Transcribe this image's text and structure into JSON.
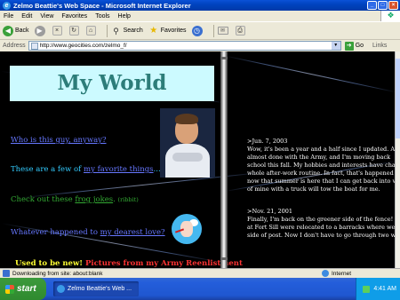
{
  "window": {
    "title": "Zelmo Beattie's Web Space - Microsoft Internet Explorer",
    "buttons": [
      "_",
      "□",
      "×"
    ]
  },
  "menu": [
    "File",
    "Edit",
    "View",
    "Favorites",
    "Tools",
    "Help"
  ],
  "toolbar": {
    "back_label": "Back",
    "search_label": "Search",
    "favorites_label": "Favorites"
  },
  "address": {
    "label": "Address",
    "url": "http://www.geocities.com/zelmo_f/",
    "go_label": "Go",
    "links_label": "Links"
  },
  "page": {
    "heading": "My World",
    "q1": "Who is this guy, anyway?",
    "q2_prefix": "These are a few of ",
    "q2_link": "my favorite things",
    "q2_suffix": "...",
    "q3_prefix": "Check out these ",
    "q3_link": "frog jokes",
    "q3_suffix": ".",
    "q3_note": "(ribbit)",
    "q4_prefix": "Whatever happened to ",
    "q4_link": "my dearest love?",
    "q5_yellow": "Used to be new!",
    "q5_red": "Pictures from my Army Reenlistment"
  },
  "news": [
    {
      "date": ">Jun. 7, 2003",
      "text": "Wow, it's been a year and a half since I updated. A\nalmost done with the Army, and I'm moving back\nschool this fall. My hobbies and interests have cha\nwhole after-work routine. In fact, that's happened\nnow that summer is here that I can get back into w\nof mine with a truck will tow the boat for me."
    },
    {
      "date": ">Nov. 21, 2001",
      "text": "Finally, I'm back on the greener side of the fence!\nat Fort Sill were relocated to a barracks where we\nside of post. Now I don't have to go through two w"
    }
  ],
  "status": {
    "text": "Downloading from site: about:blank",
    "zone": "Internet"
  },
  "taskbar": {
    "start": "start",
    "item": "Zelmo Beattie's Web ...",
    "clock": "4:41 AM"
  }
}
